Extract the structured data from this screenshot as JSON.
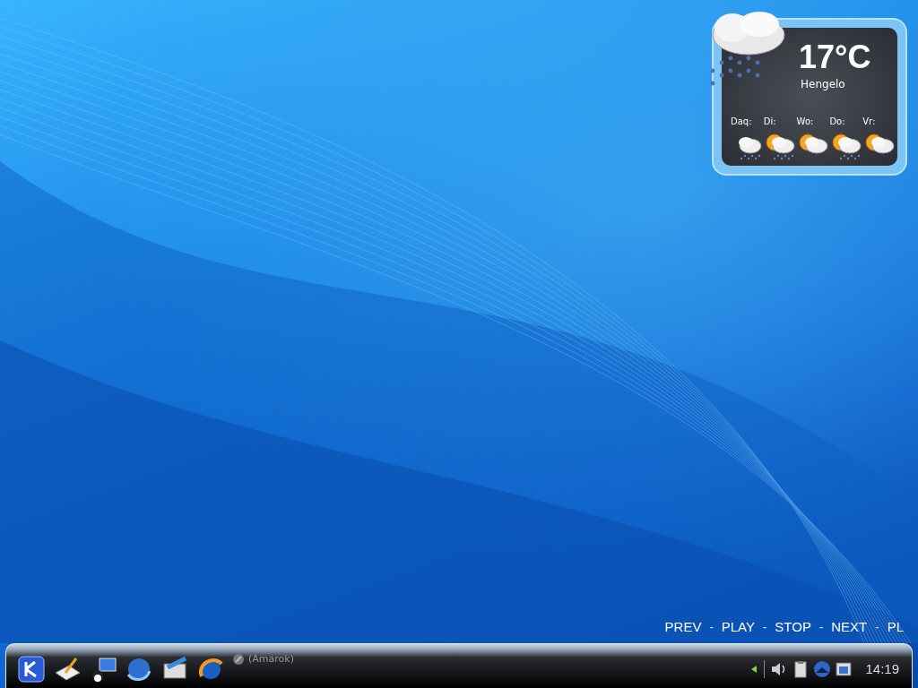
{
  "weather": {
    "temperature": "17°C",
    "city": "Hengelo",
    "forecast": [
      {
        "day": "Daq:",
        "kind": "rain"
      },
      {
        "day": "Di:",
        "kind": "sun-rain"
      },
      {
        "day": "Wo:",
        "kind": "sun-cloud"
      },
      {
        "day": "Do:",
        "kind": "sun-rain"
      },
      {
        "day": "Vr:",
        "kind": "sun-cloud"
      }
    ]
  },
  "media_controls": [
    {
      "kind": "control",
      "label": "PREV"
    },
    {
      "kind": "separator",
      "label": "-"
    },
    {
      "kind": "control",
      "label": "PLAY"
    },
    {
      "kind": "separator",
      "label": "-"
    },
    {
      "kind": "control",
      "label": "STOP"
    },
    {
      "kind": "separator",
      "label": "-"
    },
    {
      "kind": "control",
      "label": "NEXT"
    },
    {
      "kind": "separator",
      "label": "-"
    },
    {
      "kind": "control",
      "label": "PL"
    }
  ],
  "taskbar": {
    "launchers": [
      {
        "kind": "kde"
      },
      {
        "kind": "editor"
      },
      {
        "kind": "network"
      },
      {
        "kind": "browser"
      },
      {
        "kind": "mail"
      },
      {
        "kind": "globe"
      }
    ],
    "task": {
      "label": "(Amarok)"
    },
    "tray": [
      {
        "kind": "volume"
      },
      {
        "kind": "clipboard"
      },
      {
        "kind": "wolf"
      },
      {
        "kind": "updater"
      }
    ],
    "clock": "14:19"
  }
}
